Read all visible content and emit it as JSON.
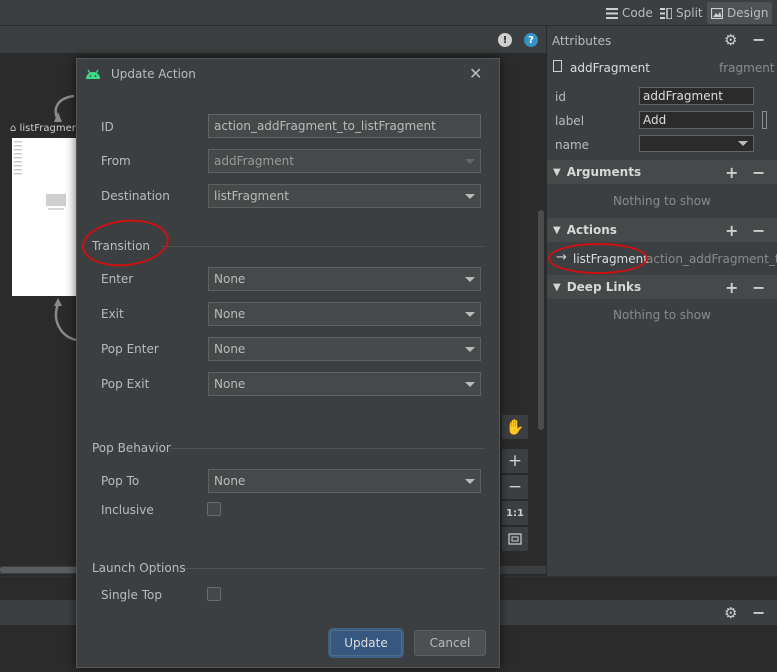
{
  "toolbar": {
    "views": [
      {
        "label": "Code"
      },
      {
        "label": "Split"
      },
      {
        "label": "Design"
      }
    ]
  },
  "canvas": {
    "fragment_label": "listFragment",
    "warning_icon": "!",
    "help_icon": "?"
  },
  "attributes": {
    "title": "Attributes",
    "fragment_name": "addFragment",
    "fragment_type": "fragment",
    "fields": [
      {
        "label": "id",
        "value": "addFragment"
      },
      {
        "label": "label",
        "value": "Add"
      },
      {
        "label": "name",
        "value": ""
      }
    ],
    "sections": {
      "arguments": {
        "title": "Arguments",
        "empty_text": "Nothing to show"
      },
      "actions": {
        "title": "Actions",
        "item_target": "listFragment",
        "item_id": "action_addFragment_to"
      },
      "deep_links": {
        "title": "Deep Links",
        "empty_text": "Nothing to show"
      }
    }
  },
  "dialog": {
    "title": "Update Action",
    "id_label": "ID",
    "id_value": "action_addFragment_to_listFragment",
    "from_label": "From",
    "from_value": "addFragment",
    "destination_label": "Destination",
    "destination_value": "listFragment",
    "transition": {
      "title": "Transition",
      "enter_label": "Enter",
      "enter_value": "None",
      "exit_label": "Exit",
      "exit_value": "None",
      "pop_enter_label": "Pop Enter",
      "pop_enter_value": "None",
      "pop_exit_label": "Pop Exit",
      "pop_exit_value": "None"
    },
    "pop_behavior": {
      "title": "Pop Behavior",
      "pop_to_label": "Pop To",
      "pop_to_value": "None",
      "inclusive_label": "Inclusive"
    },
    "launch_options": {
      "title": "Launch Options",
      "single_top_label": "Single Top"
    },
    "update_label": "Update",
    "cancel_label": "Cancel"
  },
  "tools": {
    "zoom_reset_label": "1:1"
  },
  "colors": {
    "accent": "#365880",
    "android_green": "#3ddc84",
    "annotation_red": "#d01010",
    "help_blue": "#3592c4"
  }
}
